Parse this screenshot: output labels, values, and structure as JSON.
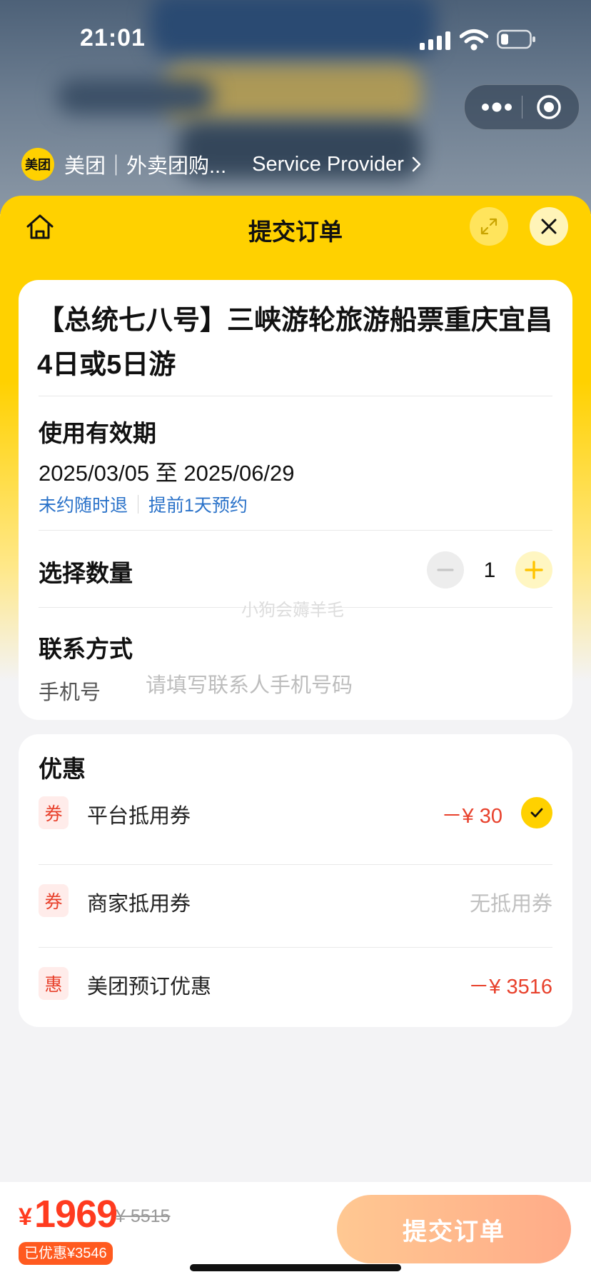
{
  "status_bar": {
    "time": "21:01"
  },
  "provider": {
    "logo_text": "美团",
    "name": "美团｜外卖团购...",
    "link": "Service Provider"
  },
  "sheet": {
    "title": "提交订单"
  },
  "product": {
    "title": "【总统七八号】三峡游轮旅游船票重庆宜昌4日或5日游",
    "validity_label": "使用有效期",
    "validity_range": "2025/03/05 至 2025/06/29",
    "tags": [
      "未约随时退",
      "提前1天预约"
    ]
  },
  "quantity": {
    "label": "选择数量",
    "value": "1"
  },
  "watermark": "小狗会薅羊毛",
  "contact": {
    "label": "联系方式",
    "phone_label": "手机号",
    "phone_value": "",
    "phone_placeholder": "请填写联系人手机号码"
  },
  "discounts": {
    "title": "优惠",
    "items": [
      {
        "badge": "券",
        "label": "平台抵用券",
        "value": "－¥ 30",
        "checked": true
      },
      {
        "badge": "券",
        "label": "商家抵用券",
        "value": "无抵用券",
        "checked": false
      },
      {
        "badge": "惠",
        "label": "美团预订优惠",
        "value": "－¥ 3516",
        "checked": false
      }
    ]
  },
  "footer": {
    "currency": "¥",
    "price": "1969",
    "original_price": "¥ 5515",
    "saved": "已优惠¥3546",
    "submit_label": "提交订单"
  },
  "colors": {
    "brand_yellow": "#ffd100",
    "price_red": "#ff3b1f",
    "discount_red": "#e8412c",
    "link_blue": "#2a72c9"
  }
}
